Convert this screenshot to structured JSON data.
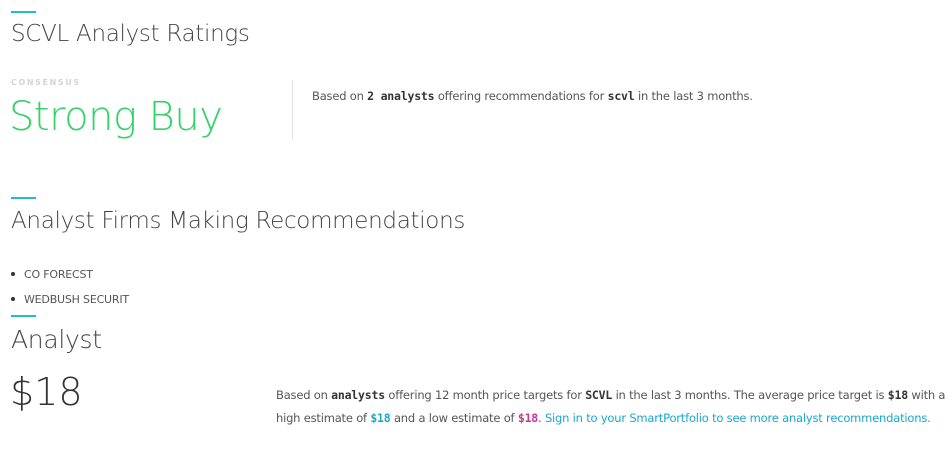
{
  "ratings": {
    "title": "SCVL Analyst Ratings",
    "consensus_label": "CONSENSUS",
    "consensus_value": "Strong Buy",
    "desc_prefix": "Based on ",
    "desc_count": "2 analysts",
    "desc_middle": " offering recommendations for ",
    "desc_ticker": "scvl",
    "desc_suffix": " in the last 3 months."
  },
  "firms": {
    "title": "Analyst Firms Making Recommendations",
    "items": [
      "CO FORECST",
      "WEDBUSH SECURIT"
    ]
  },
  "price_target": {
    "title": "Analyst",
    "value": "$18",
    "desc_prefix": "Based on ",
    "desc_analysts": "analysts",
    "desc_middle1": " offering 12 month price targets for ",
    "desc_ticker": "SCVL",
    "desc_middle2": " in the last 3 months. The average price target is ",
    "average": "$18",
    "desc_middle3": " with a high estimate of ",
    "high": "$18",
    "desc_middle4": " and a low estimate of ",
    "low": "$18",
    "desc_middle5": ". ",
    "signin_link": "Sign in to your SmartPortfolio to see more analyst recommendations."
  },
  "colors": {
    "accent": "#27b6d6",
    "consensus_green": "#33d26a",
    "high_estimate": "#19a8c9",
    "low_estimate": "#c8359a",
    "link": "#19a8c9"
  }
}
